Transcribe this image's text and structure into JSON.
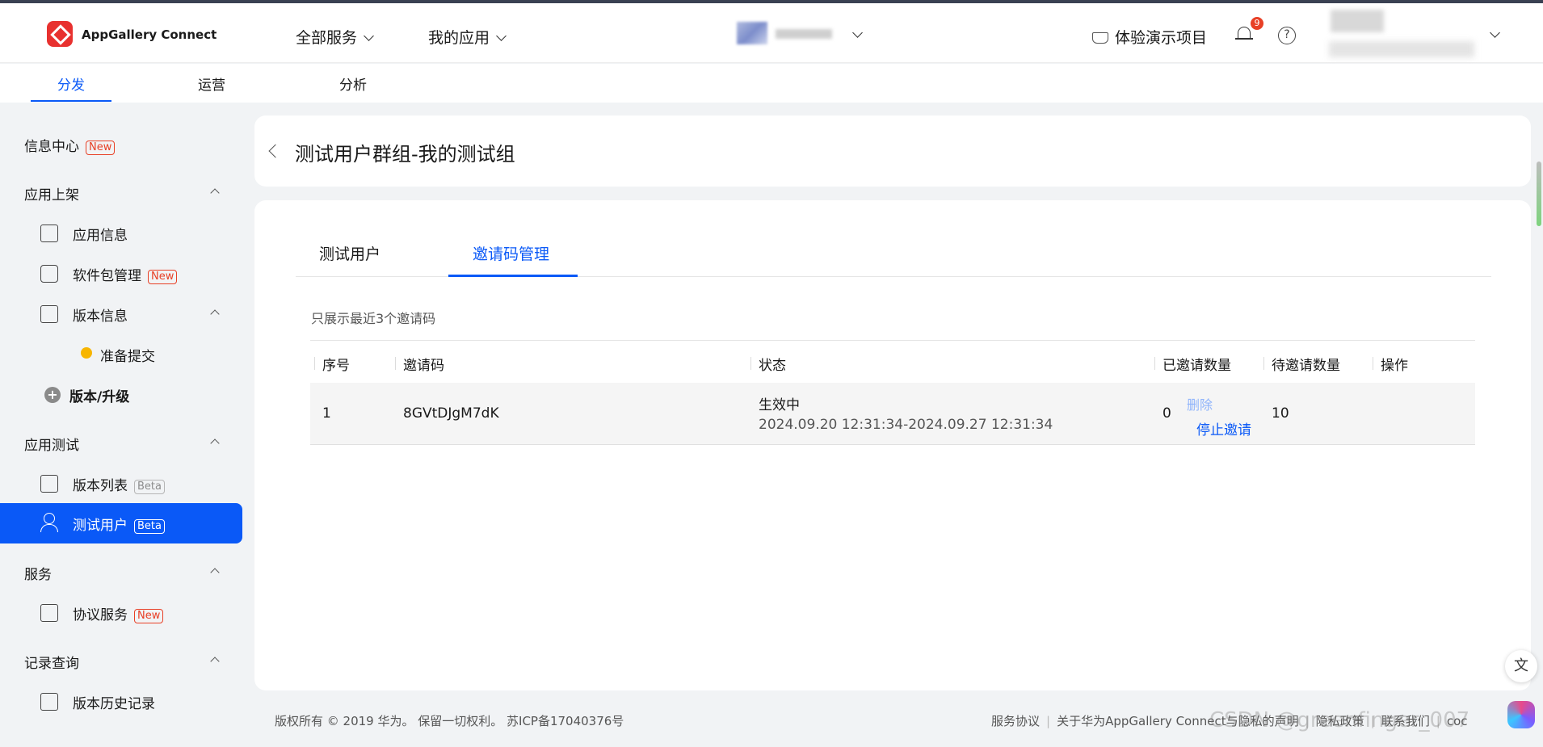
{
  "header": {
    "brand": "AppGallery Connect",
    "nav": [
      {
        "label": "全部服务"
      },
      {
        "label": "我的应用"
      }
    ],
    "demo_label": "体验演示项目",
    "notification_count": "9",
    "help_glyph": "?"
  },
  "subnav": {
    "tabs": [
      {
        "label": "分发",
        "active": true
      },
      {
        "label": "运营",
        "active": false
      },
      {
        "label": "分析",
        "active": false
      }
    ]
  },
  "sidebar": {
    "info_center": {
      "label": "信息中心",
      "tag": "New"
    },
    "groups": {
      "publish": "应用上架",
      "test": "应用测试",
      "service": "服务",
      "records": "记录查询"
    },
    "items": {
      "app_info": "应用信息",
      "package": {
        "label": "软件包管理",
        "tag": "New"
      },
      "version_info": "版本信息",
      "ready_submit": "准备提交",
      "version_upgrade": "版本/升级",
      "version_list": {
        "label": "版本列表",
        "tag": "Beta"
      },
      "test_users": {
        "label": "测试用户",
        "tag": "Beta"
      },
      "agreement": {
        "label": "协议服务",
        "tag": "New"
      },
      "version_history": "版本历史记录"
    }
  },
  "page": {
    "title": "测试用户群组-我的测试组",
    "tabs": [
      {
        "label": "测试用户",
        "active": false
      },
      {
        "label": "邀请码管理",
        "active": true
      }
    ],
    "note": "只展示最近3个邀请码"
  },
  "table": {
    "headers": {
      "index": "序号",
      "code": "邀请码",
      "status": "状态",
      "invited": "已邀请数量",
      "pending": "待邀请数量",
      "action": "操作"
    },
    "rows": [
      {
        "index": "1",
        "code": "8GVtDJgM7dK",
        "status": "生效中",
        "period": "2024.09.20 12:31:34-2024.09.27 12:31:34",
        "invited": "0",
        "pending": "10",
        "delete_label": "删除",
        "stop_label": "停止邀请"
      }
    ]
  },
  "footer": {
    "copyright": "版权所有 © 2019 华为。 保留一切权利。 苏ICP备17040376号",
    "links": [
      "服务协议",
      "关于华为AppGallery Connect与隐私的声明",
      "隐私政策",
      "联系我们",
      "coc"
    ],
    "watermark": "CSDN @greenfinger_007"
  },
  "colors": {
    "accent": "#0a59f7",
    "tag_new": "#e84026",
    "logo": "#e8312f",
    "status_dot": "#f7b500"
  },
  "icons": [
    "appgallery-logo-icon",
    "chevron-down-icon",
    "demo-project-icon",
    "bell-icon",
    "help-icon",
    "back-arrow-icon",
    "user-icon",
    "translate-icon",
    "ai-assistant-icon"
  ]
}
